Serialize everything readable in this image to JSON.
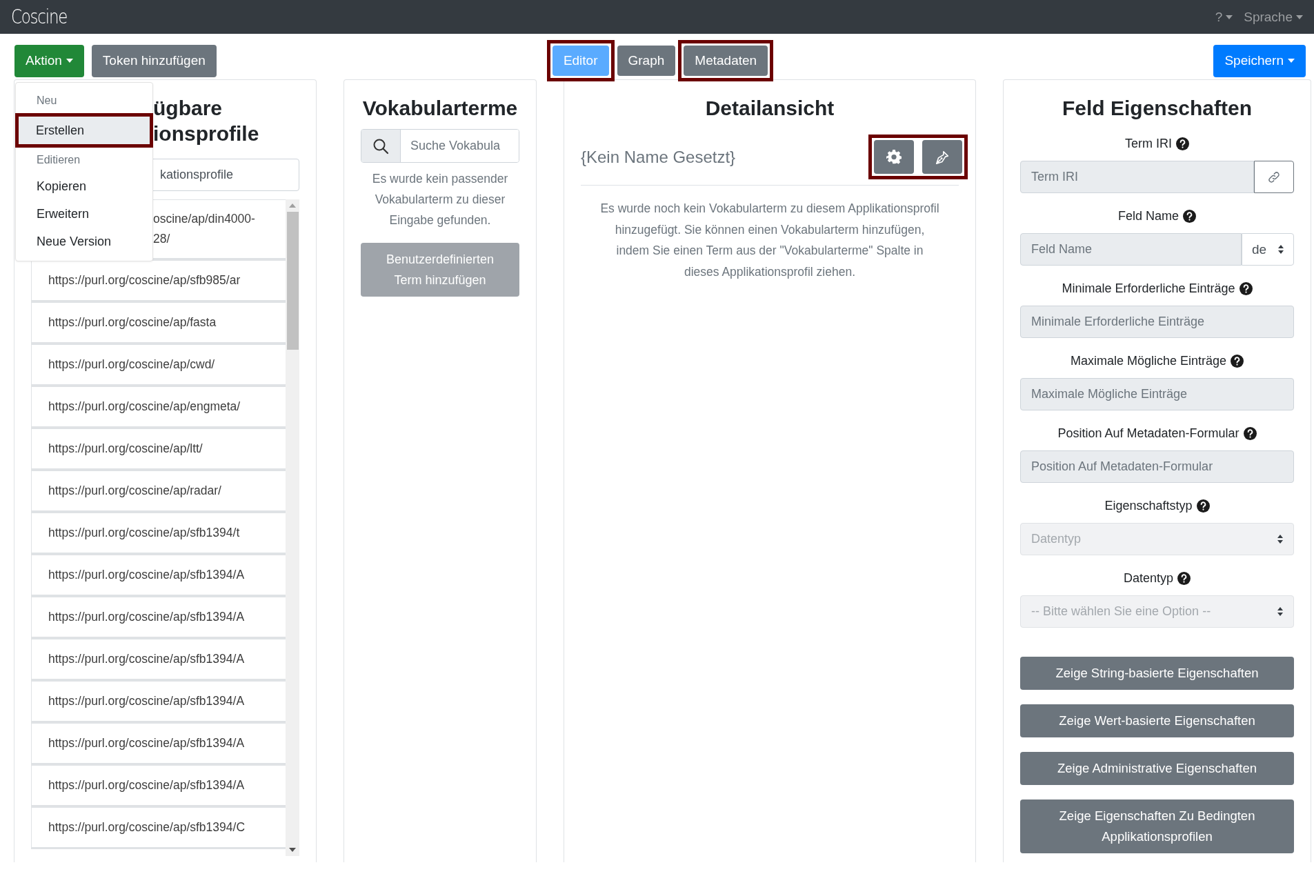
{
  "navbar": {
    "logo": "Coscine",
    "help": "?",
    "language": "Sprache"
  },
  "toolbar": {
    "action_button": "Aktion",
    "token_button": "Token hinzufügen",
    "save_button": "Speichern"
  },
  "view_tabs": [
    {
      "label": "Editor",
      "selected": true,
      "highlighted": true
    },
    {
      "label": "Graph",
      "selected": false,
      "highlighted": false
    },
    {
      "label": "Metadaten",
      "selected": false,
      "highlighted": true
    }
  ],
  "action_menu": {
    "items": [
      {
        "kind": "header",
        "label": "Neu",
        "selected": false,
        "highlighted": false
      },
      {
        "kind": "item",
        "label": "Erstellen",
        "selected": true,
        "highlighted": true
      },
      {
        "kind": "header",
        "label": "Editieren",
        "selected": false,
        "highlighted": false
      },
      {
        "kind": "item",
        "label": "Kopieren",
        "selected": false,
        "highlighted": false
      },
      {
        "kind": "item",
        "label": "Erweitern",
        "selected": false,
        "highlighted": false
      },
      {
        "kind": "item",
        "label": "Neue Version",
        "selected": false,
        "highlighted": false
      }
    ]
  },
  "profiles_column": {
    "title_lines": [
      "ügbare",
      "ionsprofile"
    ],
    "search": {
      "placeholder": "kationsprofile"
    },
    "items": [
      {
        "lines": [
          "oscine/ap/din4000-",
          "28/"
        ],
        "covered": true
      },
      {
        "lines": [
          "https://purl.org/coscine/ap/sfb985/ar"
        ],
        "covered": false
      },
      {
        "lines": [
          "https://purl.org/coscine/ap/fasta"
        ],
        "covered": false
      },
      {
        "lines": [
          "https://purl.org/coscine/ap/cwd/"
        ],
        "covered": false
      },
      {
        "lines": [
          "https://purl.org/coscine/ap/engmeta/"
        ],
        "covered": false
      },
      {
        "lines": [
          "https://purl.org/coscine/ap/ltt/"
        ],
        "covered": false
      },
      {
        "lines": [
          "https://purl.org/coscine/ap/radar/"
        ],
        "covered": false
      },
      {
        "lines": [
          "https://purl.org/coscine/ap/sfb1394/t"
        ],
        "covered": false
      },
      {
        "lines": [
          "https://purl.org/coscine/ap/sfb1394/A"
        ],
        "covered": false
      },
      {
        "lines": [
          "https://purl.org/coscine/ap/sfb1394/A"
        ],
        "covered": false
      },
      {
        "lines": [
          "https://purl.org/coscine/ap/sfb1394/A"
        ],
        "covered": false
      },
      {
        "lines": [
          "https://purl.org/coscine/ap/sfb1394/A"
        ],
        "covered": false
      },
      {
        "lines": [
          "https://purl.org/coscine/ap/sfb1394/A"
        ],
        "covered": false
      },
      {
        "lines": [
          "https://purl.org/coscine/ap/sfb1394/A"
        ],
        "covered": false
      },
      {
        "lines": [
          "https://purl.org/coscine/ap/sfb1394/C"
        ],
        "covered": false
      }
    ]
  },
  "vocabulary_column": {
    "title": "Vokabularterme",
    "search": {
      "placeholder": "Suche Vokabula"
    },
    "message": "Es wurde kein passender Vokabularterm zu dieser Eingabe gefunden.",
    "add_button": {
      "label": "Benutzerdefinierten Term hinzufügen",
      "disabled": true
    }
  },
  "detail_column": {
    "title": "Detailansicht",
    "name": "{Kein Name Gesetzt}",
    "actions_highlighted": true,
    "message": "Es wurde noch kein Vokabularterm zu diesem Applikationsprofil hinzugefügt. Sie können einen Vokabularterm hinzufügen, indem Sie einen Term aus der \"Vokabularterme\" Spalte in dieses Applikationsprofil ziehen."
  },
  "properties_column": {
    "title": "Feld Eigenschaften",
    "fields": [
      {
        "kind": "link",
        "label": "Term IRI",
        "placeholder": "Term IRI"
      },
      {
        "kind": "language",
        "label": "Feld Name",
        "placeholder": "Feld Name",
        "language": "de"
      },
      {
        "kind": "text",
        "label": "Minimale Erforderliche Einträge",
        "placeholder": "Minimale Erforderliche Einträge"
      },
      {
        "kind": "text",
        "label": "Maximale Mögliche Einträge",
        "placeholder": "Maximale Mögliche Einträge"
      },
      {
        "kind": "text",
        "label": "Position Auf Metadaten-Formular",
        "placeholder": "Position Auf Metadaten-Formular"
      },
      {
        "kind": "select",
        "label": "Eigenschaftstyp",
        "value": "Datentyp"
      },
      {
        "kind": "select",
        "label": "Datentyp",
        "value": "-- Bitte wählen Sie eine Option --"
      }
    ],
    "buttons": [
      "Zeige String-basierte Eigenschaften",
      "Zeige Wert-basierte Eigenschaften",
      "Zeige Administrative Eigenschaften",
      "Zeige Eigenschaften Zu Bedingten Applikationsprofilen"
    ]
  }
}
